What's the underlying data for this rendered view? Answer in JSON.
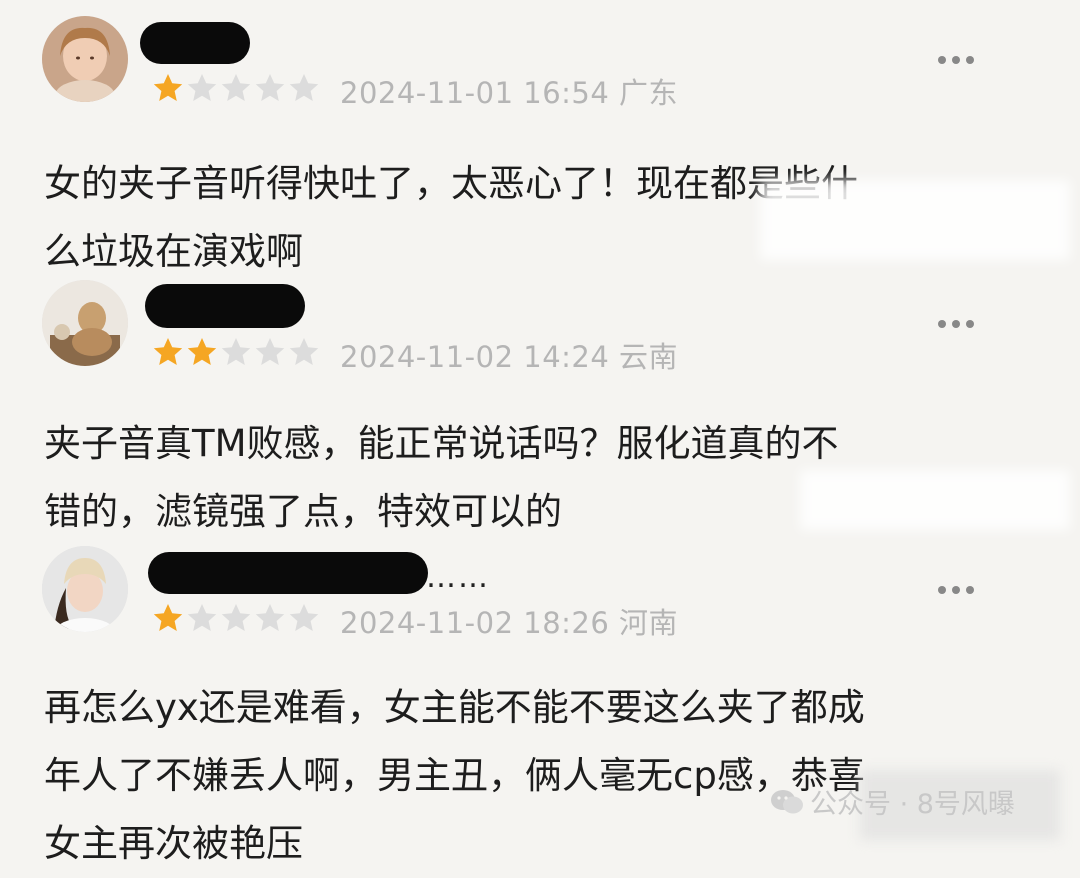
{
  "reviews": [
    {
      "rating": 1,
      "max_rating": 5,
      "date": "2024-11-01 16:54",
      "region": "广东",
      "text": "女的夹子音听得快吐了，太恶心了！现在都是些什\n么垃圾在演戏啊",
      "avatar_icon": "girl-avatar-icon"
    },
    {
      "rating": 2,
      "max_rating": 5,
      "date": "2024-11-02 14:24",
      "region": "云南",
      "text": "夹子音真TM败感，能正常说话吗？服化道真的不\n错的，滤镜强了点，特效可以的",
      "avatar_icon": "figurine-avatar-icon"
    },
    {
      "rating": 1,
      "max_rating": 5,
      "date": "2024-11-02 18:26",
      "region": "河南",
      "text": "再怎么yx还是难看，女主能不能不要这么夹了都成\n年人了不嫌丢人啊，男主丑，俩人毫无cp感，恭喜\n女主再次被艳压",
      "avatar_icon": "woman-beanie-avatar-icon",
      "username_tail": "……"
    }
  ],
  "watermark": {
    "text": "公众号 · 8号风曝"
  },
  "colors": {
    "star_filled": "#f5a623",
    "star_empty": "#dcdcdc",
    "meta_text": "#b5b5b5"
  }
}
